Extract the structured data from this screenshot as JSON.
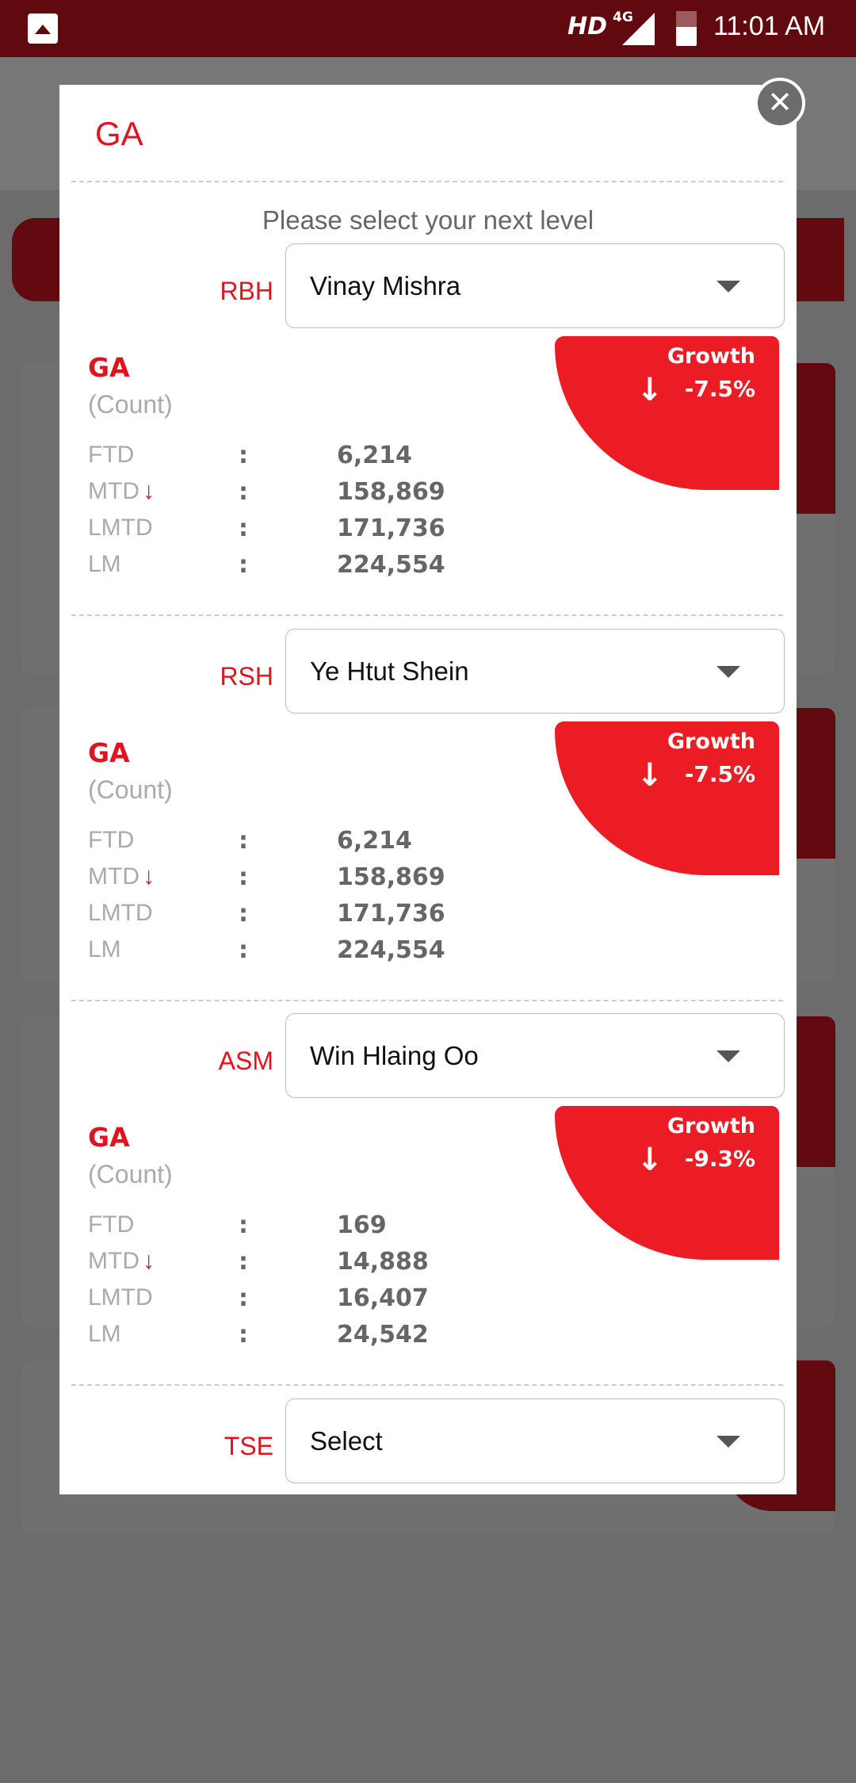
{
  "status_bar": {
    "network": "HD",
    "network_type": "4G",
    "time": "11:01 AM",
    "icons": [
      "gallery-icon",
      "signal-icon",
      "battery-icon"
    ]
  },
  "dialog": {
    "title": "GA",
    "prompt": "Please select your next level",
    "close_icon": "close-icon",
    "accent_color": "#e0141e",
    "sections": [
      {
        "level": "RBH",
        "selected": "Vinay  Mishra",
        "card": {
          "name": "GA",
          "unit": "(Count)",
          "growth_label": "Growth",
          "growth": "-7.5%",
          "rows": [
            {
              "k": "FTD",
              "v": "6,214"
            },
            {
              "k": "MTD",
              "v": "158,869",
              "down": true
            },
            {
              "k": "LMTD",
              "v": "171,736"
            },
            {
              "k": "LM",
              "v": "224,554"
            }
          ]
        }
      },
      {
        "level": "RSH",
        "selected": "Ye Htut  Shein",
        "card": {
          "name": "GA",
          "unit": "(Count)",
          "growth_label": "Growth",
          "growth": "-7.5%",
          "rows": [
            {
              "k": "FTD",
              "v": "6,214"
            },
            {
              "k": "MTD",
              "v": "158,869",
              "down": true
            },
            {
              "k": "LMTD",
              "v": "171,736"
            },
            {
              "k": "LM",
              "v": "224,554"
            }
          ]
        }
      },
      {
        "level": "ASM",
        "selected": "Win Hlaing  Oo",
        "card": {
          "name": "GA",
          "unit": "(Count)",
          "growth_label": "Growth",
          "growth": "-9.3%",
          "rows": [
            {
              "k": "FTD",
              "v": "169"
            },
            {
              "k": "MTD",
              "v": "14,888",
              "down": true
            },
            {
              "k": "LMTD",
              "v": "16,407"
            },
            {
              "k": "LM",
              "v": "24,542"
            }
          ]
        }
      },
      {
        "level": "TSE",
        "selected": "Select"
      }
    ],
    "separator": ":"
  }
}
